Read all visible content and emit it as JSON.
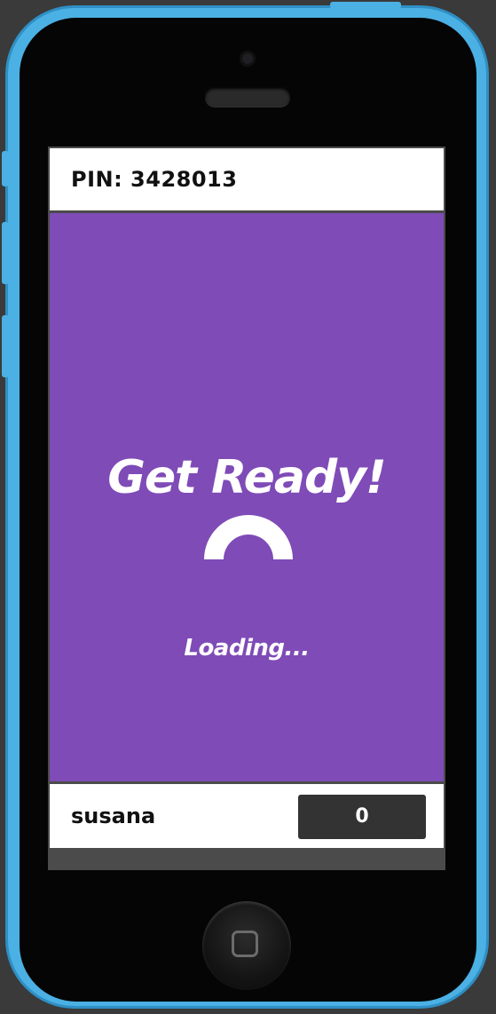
{
  "header": {
    "pin_label": "PIN: 3428013"
  },
  "main": {
    "title": "Get Ready!",
    "status": "Loading...",
    "background_color": "#7f4bb7"
  },
  "footer": {
    "nickname": "susana",
    "score": "0"
  },
  "device": {
    "frame_color": "#4bb0e3",
    "icons": [
      "camera-icon",
      "speaker-icon",
      "home-button-icon"
    ]
  }
}
